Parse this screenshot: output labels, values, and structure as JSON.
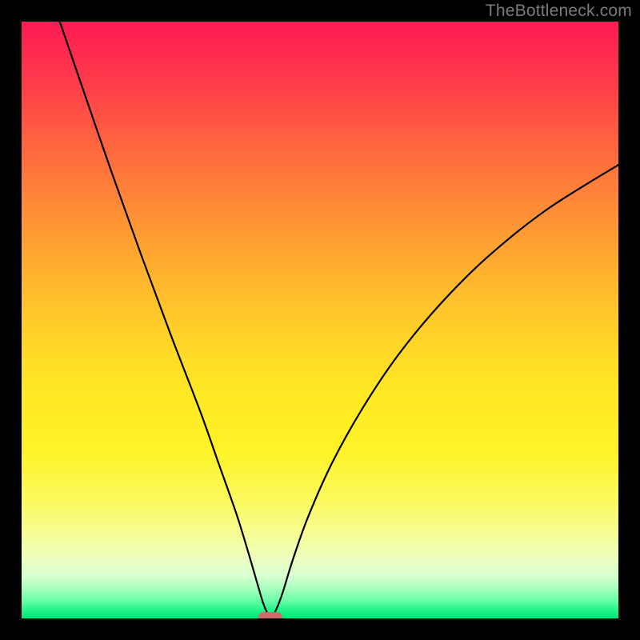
{
  "watermark": "TheBottleneck.com",
  "chart_data": {
    "type": "line",
    "title": "",
    "xlabel": "",
    "ylabel": "",
    "xlim": [
      0,
      100
    ],
    "ylim": [
      0,
      100
    ],
    "grid": false,
    "background_gradient": {
      "top": "#ff1a54",
      "mid": "#ffe824",
      "bottom": "#06e47a"
    },
    "series": [
      {
        "name": "bottleneck-curve",
        "color": "#000000",
        "x": [
          6.4,
          10,
          15,
          20,
          25,
          30,
          33,
          36,
          38,
          39.6,
          40.5,
          41.4,
          42.0,
          42.8,
          43.8,
          45.5,
          48,
          52,
          57,
          63,
          70,
          78,
          88,
          100
        ],
        "y": [
          100,
          89.5,
          75,
          61,
          47.5,
          34.5,
          26,
          17.5,
          11,
          5.5,
          2.5,
          0.5,
          0.4,
          1.8,
          4.5,
          10,
          17,
          26,
          35,
          44,
          52.5,
          60.5,
          68.5,
          76
        ]
      }
    ],
    "marker": {
      "name": "optimal-point",
      "x": 41.7,
      "y": 0.2,
      "color": "#cd6a6a"
    }
  }
}
